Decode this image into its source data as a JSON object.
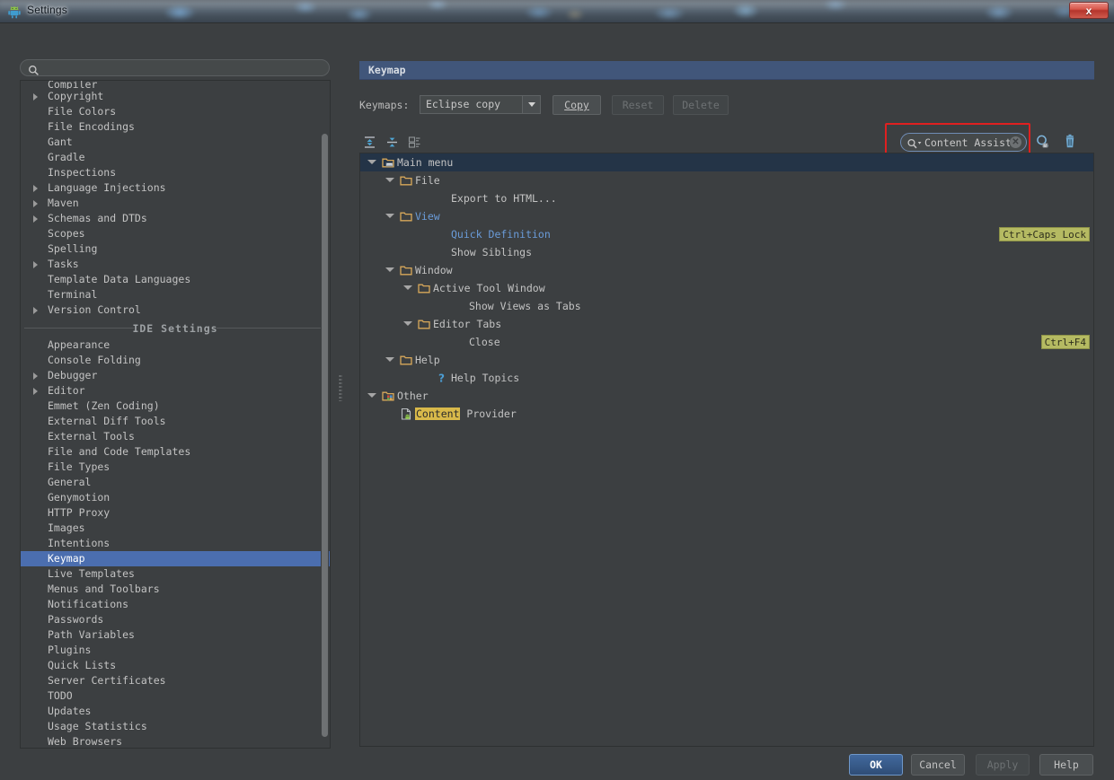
{
  "window": {
    "title": "Settings",
    "app_icon": "android-icon",
    "close_label": "x"
  },
  "left": {
    "search": {
      "value": "",
      "placeholder": "",
      "icon": "search-icon"
    },
    "project_items": [
      {
        "label": "Compiler",
        "arrow": false,
        "clipped": true
      },
      {
        "label": "Copyright",
        "arrow": true
      },
      {
        "label": "File Colors",
        "arrow": false
      },
      {
        "label": "File Encodings",
        "arrow": false
      },
      {
        "label": "Gant",
        "arrow": false
      },
      {
        "label": "Gradle",
        "arrow": false
      },
      {
        "label": "Inspections",
        "arrow": false
      },
      {
        "label": "Language Injections",
        "arrow": true
      },
      {
        "label": "Maven",
        "arrow": true
      },
      {
        "label": "Schemas and DTDs",
        "arrow": true
      },
      {
        "label": "Scopes",
        "arrow": false
      },
      {
        "label": "Spelling",
        "arrow": false
      },
      {
        "label": "Tasks",
        "arrow": true
      },
      {
        "label": "Template Data Languages",
        "arrow": false
      },
      {
        "label": "Terminal",
        "arrow": false
      },
      {
        "label": "Version Control",
        "arrow": true
      }
    ],
    "section_label": "IDE Settings",
    "ide_items": [
      {
        "label": "Appearance",
        "arrow": false
      },
      {
        "label": "Console Folding",
        "arrow": false
      },
      {
        "label": "Debugger",
        "arrow": true
      },
      {
        "label": "Editor",
        "arrow": true
      },
      {
        "label": "Emmet (Zen Coding)",
        "arrow": false
      },
      {
        "label": "External Diff Tools",
        "arrow": false
      },
      {
        "label": "External Tools",
        "arrow": false
      },
      {
        "label": "File and Code Templates",
        "arrow": false
      },
      {
        "label": "File Types",
        "arrow": false
      },
      {
        "label": "General",
        "arrow": false
      },
      {
        "label": "Genymotion",
        "arrow": false
      },
      {
        "label": "HTTP Proxy",
        "arrow": false
      },
      {
        "label": "Images",
        "arrow": false
      },
      {
        "label": "Intentions",
        "arrow": false
      },
      {
        "label": "Keymap",
        "arrow": false,
        "selected": true
      },
      {
        "label": "Live Templates",
        "arrow": false
      },
      {
        "label": "Menus and Toolbars",
        "arrow": false
      },
      {
        "label": "Notifications",
        "arrow": false
      },
      {
        "label": "Passwords",
        "arrow": false
      },
      {
        "label": "Path Variables",
        "arrow": false
      },
      {
        "label": "Plugins",
        "arrow": false
      },
      {
        "label": "Quick Lists",
        "arrow": false
      },
      {
        "label": "Server Certificates",
        "arrow": false
      },
      {
        "label": "TODO",
        "arrow": false
      },
      {
        "label": "Updates",
        "arrow": false
      },
      {
        "label": "Usage Statistics",
        "arrow": false
      },
      {
        "label": "Web Browsers",
        "arrow": false
      }
    ]
  },
  "right": {
    "header_title": "Keymap",
    "keymaps_label": "Keymaps:",
    "keymap_selected": "Eclipse copy",
    "buttons": {
      "copy": "Copy",
      "reset": "Reset",
      "delete": "Delete"
    },
    "toolbar_icons": [
      "expand-all-icon",
      "collapse-all-icon",
      "edit-shortcut-icon"
    ],
    "filter": {
      "value": "Content Assist",
      "search_icon": "search-icon",
      "clear_icon": "clear-icon",
      "find_shortcut_icon": "find-by-shortcut-icon",
      "reset_filter_icon": "trash-icon"
    },
    "tree": [
      {
        "label": "Main menu",
        "indent": 0,
        "arrow": true,
        "icon": "main-menu-icon",
        "selected": true
      },
      {
        "label": "File",
        "indent": 1,
        "arrow": true,
        "icon": "folder-icon"
      },
      {
        "label": "Export to HTML...",
        "indent": 3,
        "arrow": false,
        "icon": ""
      },
      {
        "label": "View",
        "indent": 1,
        "arrow": true,
        "icon": "folder-icon",
        "blue": true
      },
      {
        "label": "Quick Definition",
        "indent": 3,
        "arrow": false,
        "icon": "",
        "blue": true,
        "shortcut": "Ctrl+Caps Lock"
      },
      {
        "label": "Show Siblings",
        "indent": 3,
        "arrow": false,
        "icon": ""
      },
      {
        "label": "Window",
        "indent": 1,
        "arrow": true,
        "icon": "folder-icon"
      },
      {
        "label": "Active Tool Window",
        "indent": 2,
        "arrow": true,
        "icon": "folder-icon"
      },
      {
        "label": "Show Views as Tabs",
        "indent": 4,
        "arrow": false,
        "icon": ""
      },
      {
        "label": "Editor Tabs",
        "indent": 2,
        "arrow": true,
        "icon": "folder-icon"
      },
      {
        "label": "Close",
        "indent": 4,
        "arrow": false,
        "icon": "",
        "shortcut": "Ctrl+F4"
      },
      {
        "label": "Help",
        "indent": 1,
        "arrow": true,
        "icon": "folder-icon"
      },
      {
        "label": "Help Topics",
        "indent": 3,
        "arrow": false,
        "icon": "question-icon"
      },
      {
        "label": "Other",
        "indent": 0,
        "arrow": true,
        "icon": "other-folder-icon"
      },
      {
        "label": "Content Provider",
        "indent": 1,
        "arrow": false,
        "icon": "file-icon",
        "match": "Content"
      }
    ]
  },
  "footer": {
    "ok": "OK",
    "cancel": "Cancel",
    "apply": "Apply",
    "help": "Help"
  },
  "colors": {
    "accent_selection": "#4b6eaf",
    "header_bar": "#41567a",
    "tree_selection": "#243447",
    "shortcut_badge": "#b5ba62",
    "match_highlight": "#d8b94a",
    "annotation_red": "#e02020",
    "blue_text": "#6a9bd8",
    "background": "#3c3f41"
  }
}
